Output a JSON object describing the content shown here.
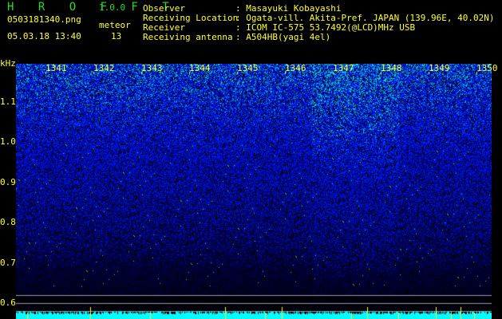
{
  "app": {
    "name": "H R O F F T",
    "version": "1.0.0"
  },
  "file": {
    "filename": "0503181340.png",
    "datetime": "05.03.18 13:40"
  },
  "meteor": {
    "label": "meteor",
    "count": "13"
  },
  "info": [
    {
      "label": "Observer",
      "value": ": Masayuki Kobayashi"
    },
    {
      "label": "Receiving Location",
      "value": ": Ogata-vill. Akita-Pref. JAPAN (139.96E, 40.02N)"
    },
    {
      "label": "Receiver",
      "value": ": ICOM IC-575 53.7492(@LCD)MHz USB"
    },
    {
      "label": "Receiving antenna",
      "value": ": A504HB(yagi 4el)"
    }
  ],
  "axis": {
    "unit": "kHz",
    "freq_labels": [
      "1.1",
      "1.0",
      "0.9",
      "0.8",
      "0.7",
      "0.6"
    ],
    "minute_labels": [
      "1341",
      "1342",
      "1343",
      "1344",
      "1345",
      "1346",
      "1347",
      "1348",
      "1349",
      "1350"
    ]
  },
  "colors": {
    "text": "#ffff33",
    "title": "#22dd22",
    "level": "#00ffff",
    "grid": "#999999"
  }
}
